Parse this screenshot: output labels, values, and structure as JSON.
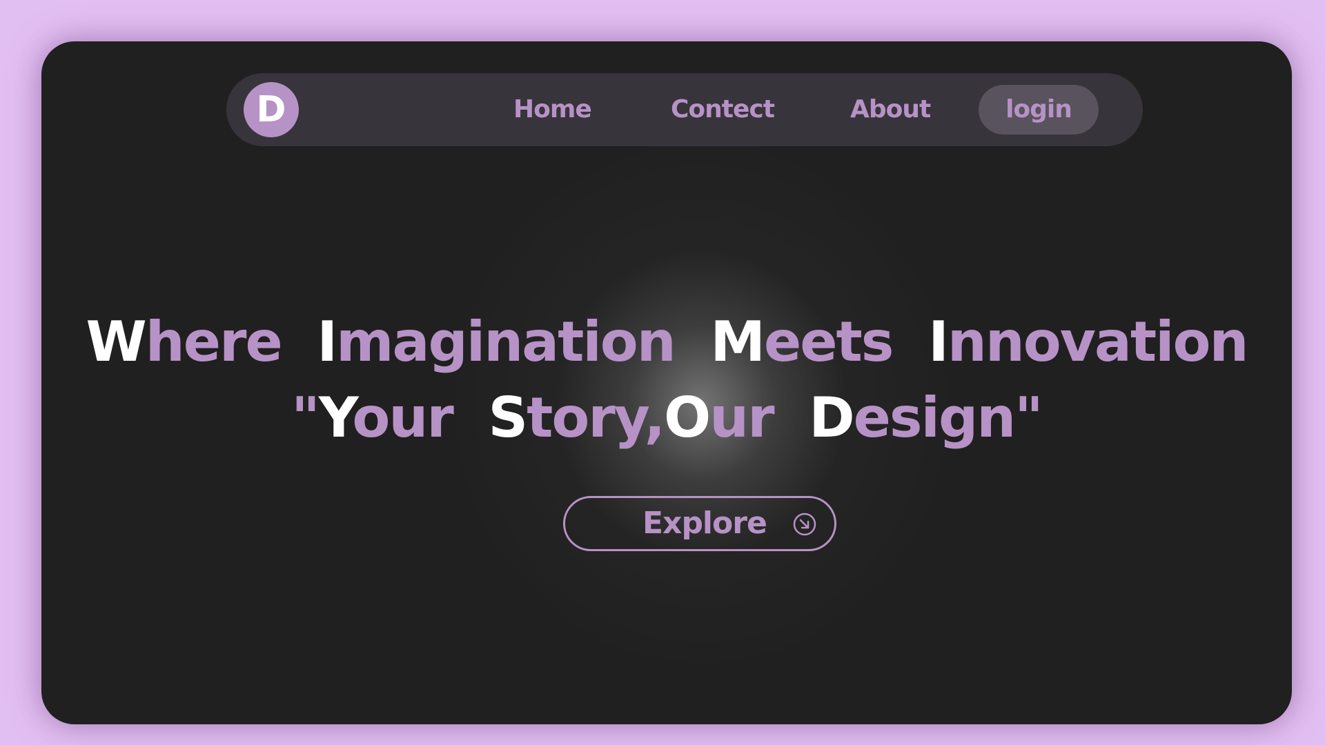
{
  "brand": {
    "logo_letter": "D",
    "accent_color": "#b792c6",
    "background_color": "#e2bff2",
    "panel_color": "#202020"
  },
  "nav": {
    "items": [
      {
        "label": "Home"
      },
      {
        "label": "Contect"
      },
      {
        "label": "About"
      }
    ],
    "login_label": "login"
  },
  "hero": {
    "line1": [
      {
        "cap": "W",
        "rest": "here"
      },
      {
        "cap": "I",
        "rest": "magination"
      },
      {
        "cap": "M",
        "rest": "eets"
      },
      {
        "cap": "I",
        "rest": "nnovation"
      }
    ],
    "line2": {
      "open_quote": "\"",
      "w1_cap": "Y",
      "w1_rest": "our",
      "w2_cap": "S",
      "w2_rest": "tory,",
      "w3_cap": "O",
      "w3_rest": "ur",
      "w4_cap": "D",
      "w4_rest": "esign",
      "close_quote": "\""
    },
    "cta": {
      "label": "Explore",
      "icon": "arrow-down-right-circle-icon"
    }
  }
}
